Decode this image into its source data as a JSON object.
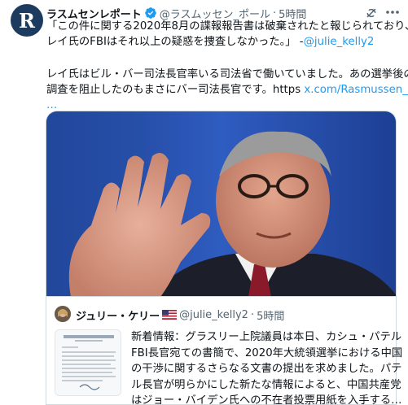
{
  "author": {
    "avatar_letter": "R",
    "display_name": "ラスムセンレポート",
    "handle": "@ラスムッセン_ポール",
    "separator": "·",
    "time": "5時間"
  },
  "tweet": {
    "lines": [
      "「この件に関する2020年8月の諜報報告書は破棄されたと報じられており、",
      "レイ氏のFBIはそれ以上の疑惑を捜査しなかった。」 -",
      "レイ氏はビル・バー司法長官率いる司法省で働いていました。あの選挙後の",
      "調査を阻止したのもまさにバー司法長官です。https "
    ],
    "mention": "@julie_kelly2",
    "link": "x.com/Rasmussen_Poll",
    "ellipsis": "…"
  },
  "quote": {
    "display_name": "ジュリー・ケリー",
    "handle": "@julie_kelly2",
    "separator": "·",
    "time": "5時間",
    "lines": [
      "新着情報：グラスリー上院議員は本日、カシュ・パテル",
      "FBI長官宛ての書簡で、2020年大統領選挙における中国",
      "の干渉に関するさらなる文書の提出を求めました。パテ",
      "ル長官が明らかにした新たな情報によると、中国共産党",
      "はジョー・バイデン氏への不在者投票用紙を入手する…"
    ]
  },
  "icons": {
    "verified": "verified-badge-icon",
    "grok": "grok-icon",
    "more": "more-options-icon",
    "flag": "us-flag-icon"
  },
  "colors": {
    "accent": "#1d9bf0",
    "secondary_text": "#536471",
    "border": "#cfd9de"
  }
}
